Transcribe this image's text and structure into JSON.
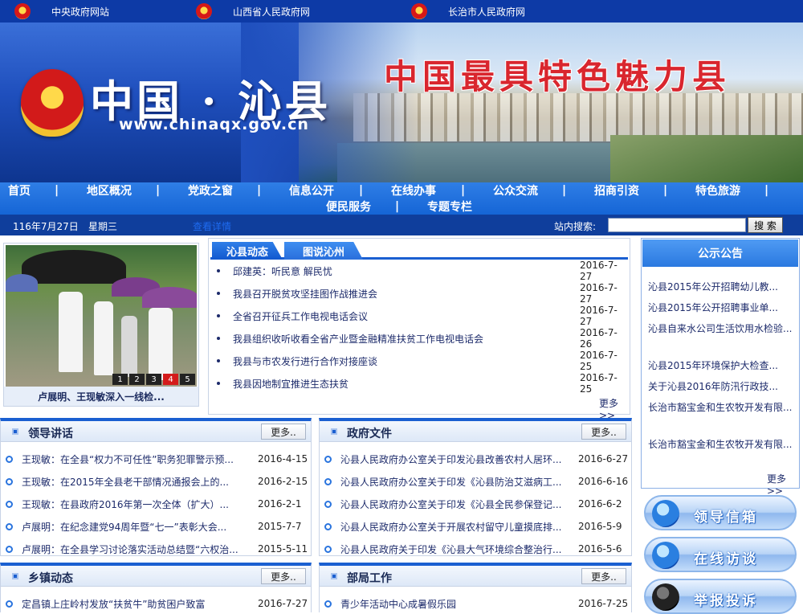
{
  "top_links": [
    "中央政府网站",
    "山西省人民政府网",
    "长治市人民政府网"
  ],
  "banner": {
    "site_name": "中国 · 沁县",
    "url": "www.chinaqx.gov.cn",
    "slogan": "中国最具特色魅力县"
  },
  "nav": {
    "row1": [
      "首页",
      "地区概况",
      "党政之窗",
      "信息公开",
      "在线办事",
      "公众交流",
      "招商引资",
      "特色旅游"
    ],
    "row2": [
      "便民服务",
      "专题专栏"
    ],
    "separator": "|"
  },
  "datebar": {
    "date": "116年7月27日",
    "weekday": "星期三",
    "link": "查看详情",
    "search_label": "站内搜索:",
    "search_button": "搜 索",
    "search_value": ""
  },
  "slider": {
    "caption": "卢展明、王现敏深入一线检...",
    "pages": [
      "1",
      "2",
      "3",
      "4",
      "5"
    ],
    "active_page": "4"
  },
  "news": {
    "tabs": [
      "沁县动态",
      "图说沁州"
    ],
    "items": [
      {
        "title": "邱建英：听民意 解民忧",
        "date": "2016-7-27"
      },
      {
        "title": "我县召开脱贫攻坚挂图作战推进会",
        "date": "2016-7-27"
      },
      {
        "title": "全省召开征兵工作电视电话会议",
        "date": "2016-7-27"
      },
      {
        "title": "我县组织收听收看全省产业暨金融精准扶贫工作电视电话会",
        "date": "2016-7-26"
      },
      {
        "title": "我县与市农发行进行合作对接座谈",
        "date": "2016-7-25"
      },
      {
        "title": "我县因地制宜推进生态扶贫",
        "date": "2016-7-25"
      }
    ],
    "more": "更多>>"
  },
  "notice": {
    "title": "公示公告",
    "items": [
      "沁县2015年公开招聘幼儿教...",
      "沁县2015年公开招聘事业单...",
      "沁县自来水公司生活饮用水检验...",
      "沁县2015年环境保护大检查...",
      "关于沁县2016年防汛行政技...",
      "长治市豁宝金和生农牧开发有限...",
      "长治市豁宝金和生农牧开发有限..."
    ],
    "more": "更多>>"
  },
  "services": [
    "领导信箱",
    "在线访谈",
    "举报投诉"
  ],
  "sections": {
    "leader": {
      "title": "领导讲话",
      "more": "更多..",
      "items": [
        {
          "title": "王现敏：在全县“权力不可任性”职务犯罪警示预...",
          "date": "2016-4-15"
        },
        {
          "title": "王现敏：在2015年全县老干部情况通报会上的...",
          "date": "2016-2-15"
        },
        {
          "title": "王现敏：在县政府2016年第一次全体（扩大）...",
          "date": "2016-2-1"
        },
        {
          "title": "卢展明：在纪念建党94周年暨“七一”表彰大会...",
          "date": "2015-7-7"
        },
        {
          "title": "卢展明：在全县学习讨论落实活动总结暨“六权治...",
          "date": "2015-5-11"
        }
      ]
    },
    "gov": {
      "title": "政府文件",
      "more": "更多..",
      "items": [
        {
          "title": "沁县人民政府办公室关于印发沁县改善农村人居环...",
          "date": "2016-6-27"
        },
        {
          "title": "沁县人民政府办公室关于印发《沁县防治艾滋病工...",
          "date": "2016-6-16"
        },
        {
          "title": "沁县人民政府办公室关于印发《沁县全民参保登记...",
          "date": "2016-6-2"
        },
        {
          "title": "沁县人民政府办公室关于开展农村留守儿童摸底排...",
          "date": "2016-5-9"
        },
        {
          "title": "沁县人民政府关于印发《沁县大气环境综合整治行...",
          "date": "2016-5-6"
        }
      ]
    },
    "town": {
      "title": "乡镇动态",
      "more": "更多..",
      "items": [
        {
          "title": "定昌镇上庄岭村发放“扶贫牛”助贫困户致富",
          "date": "2016-7-27"
        }
      ]
    },
    "dept": {
      "title": "部局工作",
      "more": "更多..",
      "items": [
        {
          "title": "青少年活动中心成暑假乐园",
          "date": "2016-7-25"
        }
      ]
    }
  },
  "colors": {
    "primary": "#1a5fd1",
    "top_bar": "#0d3aa6",
    "slogan_red": "#d9262e"
  }
}
